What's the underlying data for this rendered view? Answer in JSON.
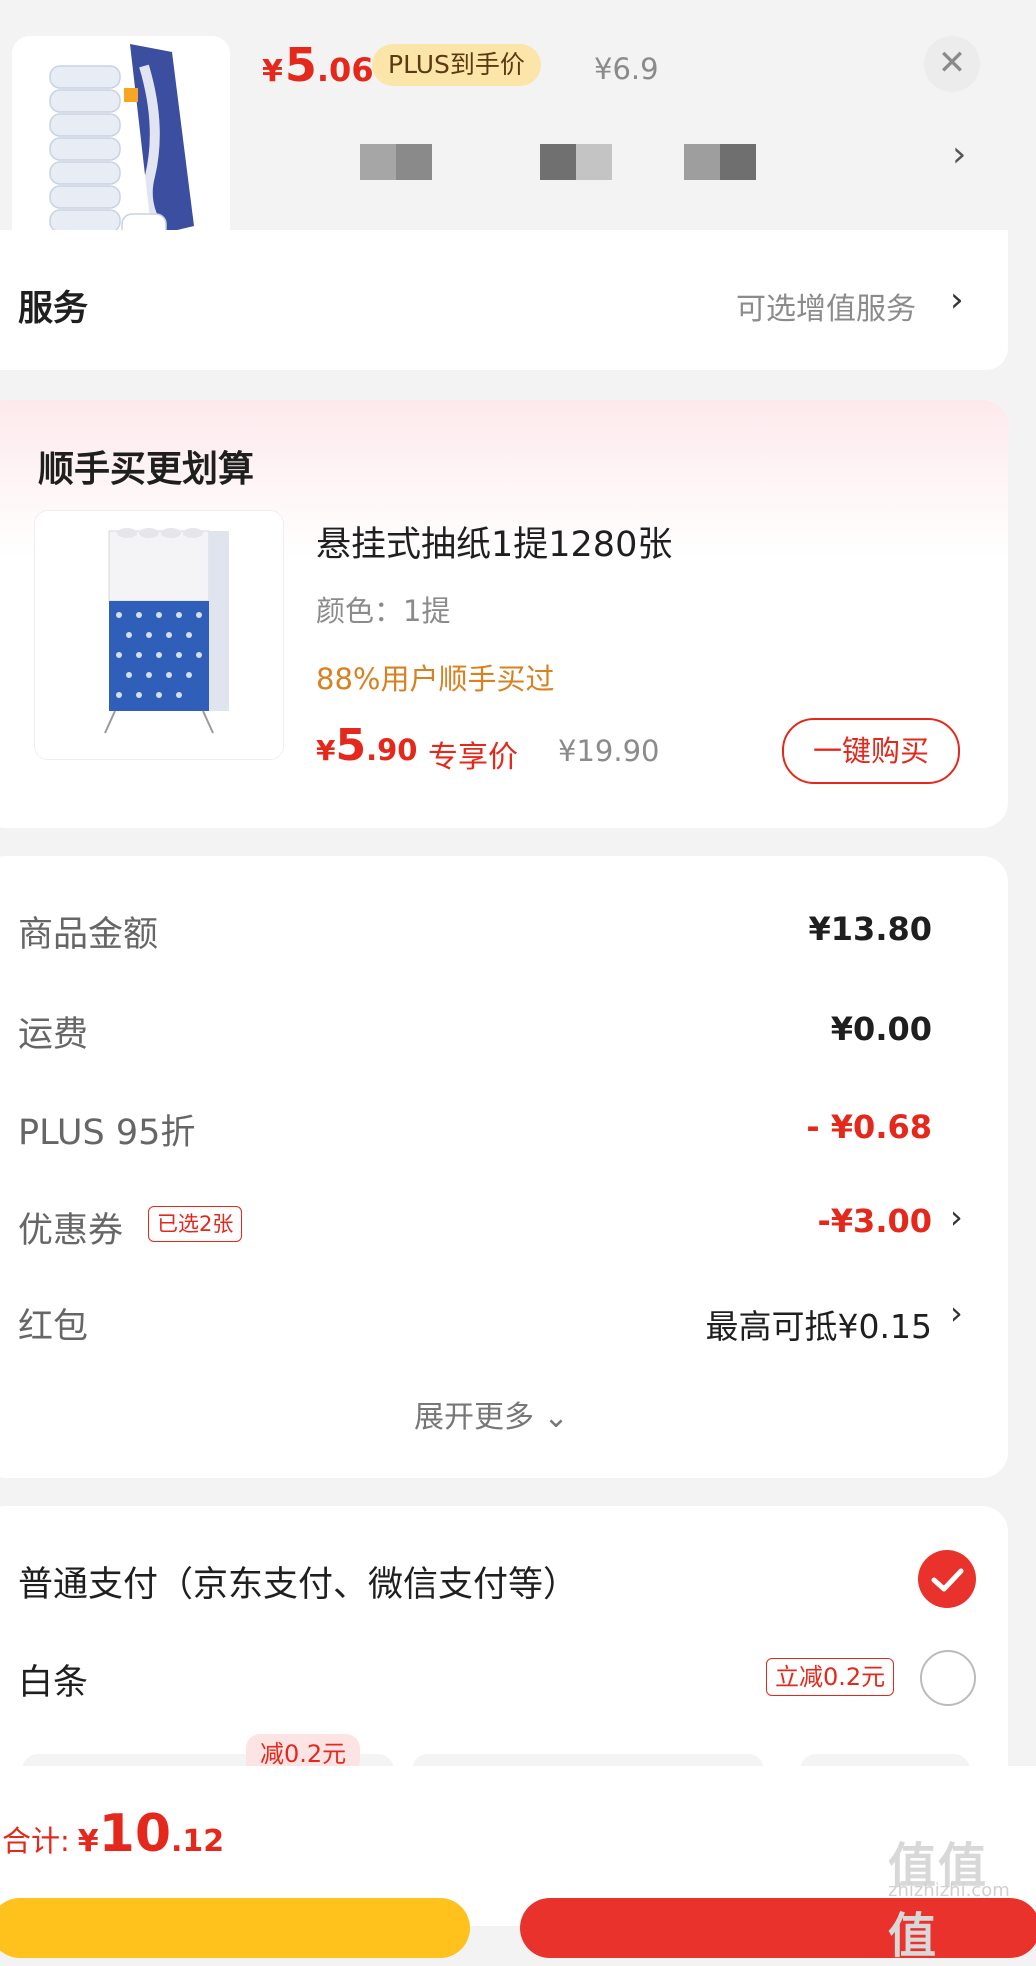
{
  "header": {
    "price_currency": "¥",
    "price_int": "5",
    "price_dec": ".06",
    "plus_badge": "PLUS到手价",
    "original_price": "¥6.9",
    "close_icon": "close-icon",
    "next_icon": "chevron-right-icon"
  },
  "service": {
    "label": "服务",
    "value": "可选增值服务",
    "arrow": "›"
  },
  "bundle": {
    "title": "顺手买更划算",
    "product_name": "悬挂式抽纸1提1280张",
    "spec": "颜色：1提",
    "tip": "88%用户顺手买过",
    "price_currency": "¥",
    "price_int": "5",
    "price_dec": ".90",
    "exclusive_label": "专享价",
    "original_price": "¥19.90",
    "buy_button": "一键购买"
  },
  "amounts": {
    "goods_label": "商品金额",
    "goods_value": "¥13.80",
    "shipping_label": "运费",
    "shipping_value": "¥0.00",
    "plus_label": "PLUS 95折",
    "plus_value": "- ¥0.68",
    "coupon_label": "优惠券",
    "coupon_tag": "已选2张",
    "coupon_value": "-¥3.00",
    "redpacket_label": "红包",
    "redpacket_value": "最高可抵¥0.15",
    "arrow": "›",
    "expand_more": "展开更多 ⌄"
  },
  "payment": {
    "normal_label": "普通支付（京东支付、微信支付等）",
    "baitiao_label": "白条",
    "baitiao_discount": "立减0.2元",
    "plan_badge": "减0.2元",
    "selected": "normal"
  },
  "footer": {
    "total_label": "合计:",
    "total_currency": "¥",
    "total_int": "10",
    "total_dec": ".12",
    "watermark": "值值值",
    "watermark_sub": "zhizhizhi.com"
  },
  "colors": {
    "accent_red": "#e4281c",
    "plus_gold": "#fbe5a8",
    "tip_orange": "#d78120"
  }
}
